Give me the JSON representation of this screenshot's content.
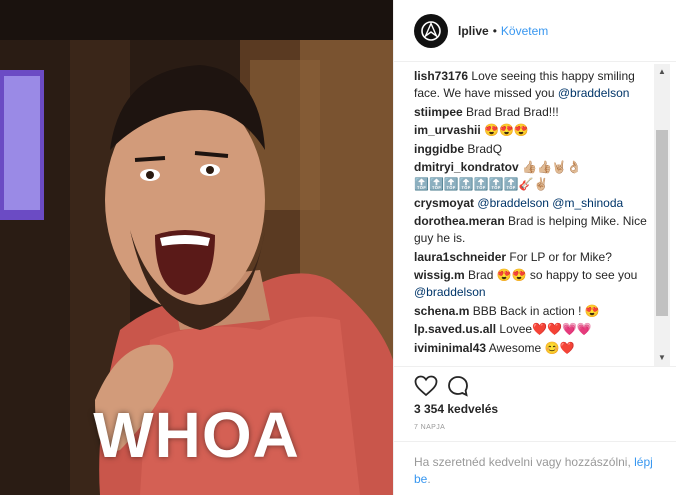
{
  "media": {
    "caption": "WHOA"
  },
  "header": {
    "username": "lplive",
    "dot": "•",
    "follow_label": "Követem"
  },
  "comments": [
    {
      "user": "lish73176",
      "text": "Love seeing this happy smiling face. We have missed you ",
      "mention": "@braddelson",
      "tail": ""
    },
    {
      "user": "stiimpee",
      "text": "Brad Brad Brad!!!",
      "mention": "",
      "tail": ""
    },
    {
      "user": "im_urvashii",
      "text": "😍😍😍",
      "mention": "",
      "tail": ""
    },
    {
      "user": "inggidbe",
      "text": "BradQ",
      "mention": "",
      "tail": ""
    },
    {
      "user": "dmitryi_kondratov",
      "text": "👍🏼👍🏼🤘🏼👌🏼🔝🔝🔝🔝🔝🔝🔝🎸✌🏼",
      "mention": "",
      "tail": ""
    },
    {
      "user": "crysmoyat",
      "text": "",
      "mention": "@braddelson",
      "tail": " @m_shinoda"
    },
    {
      "user": "dorothea.meran",
      "text": "Brad is helping Mike. Nice guy he is.",
      "mention": "",
      "tail": ""
    },
    {
      "user": "laura1schneider",
      "text": "For LP or for Mike?",
      "mention": "",
      "tail": ""
    },
    {
      "user": "wissig.m",
      "text": "Brad 😍😍 so happy to see you ",
      "mention": "@braddelson",
      "tail": ""
    },
    {
      "user": "schena.m",
      "text": "BBB Back in action ! 😍",
      "mention": "",
      "tail": ""
    },
    {
      "user": "lp.saved.us.all",
      "text": "Lovee❤️❤️💗💗",
      "mention": "",
      "tail": ""
    },
    {
      "user": "iviminimal43",
      "text": "Awesome 😊❤️",
      "mention": "",
      "tail": ""
    }
  ],
  "likes": "3 354 kedvelés",
  "date": "7 NAPJA",
  "login": {
    "prefix": "Ha szeretnéd kedvelni vagy hozzászólni, ",
    "link": "lépj be",
    "suffix": "."
  },
  "icons": {
    "like": "heart-icon",
    "comment": "comment-icon",
    "avatar": "linkin-park-logo"
  },
  "colors": {
    "link_blue": "#3897f0",
    "mention_blue": "#003569",
    "muted": "#999999"
  }
}
